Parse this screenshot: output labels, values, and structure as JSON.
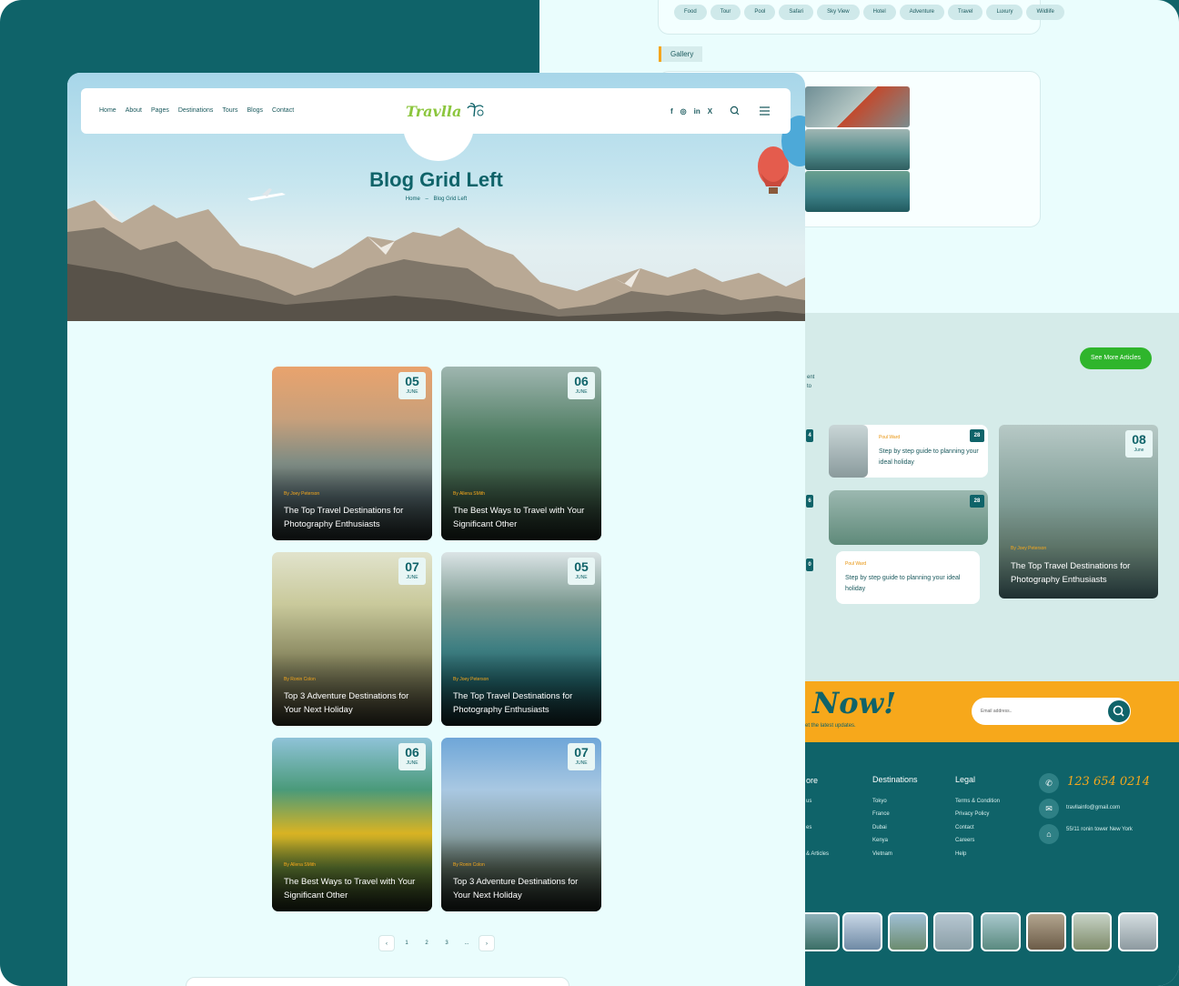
{
  "colors": {
    "teal": "#0f6369",
    "orange": "#f7a81b",
    "green": "#2fb52c",
    "lime": "#8cc63e",
    "mint": "#eafdfd"
  },
  "background_page": {
    "tags": [
      "Food",
      "Tour",
      "Pool",
      "Safari",
      "Sky View",
      "Hotel",
      "Adventure",
      "Travel",
      "Luxury",
      "Wildlife"
    ],
    "gallery_label": "Gallery",
    "see_more": "See More Articles",
    "frag_ent": "ent",
    "frag_to": "to",
    "posts": [
      {
        "author": "Poul Ward",
        "date_day": "28",
        "date_month": "June",
        "title": "Step by step guide to planning your ideal holiday"
      },
      {
        "author": "Poul Ward",
        "date_day": "28",
        "date_month": "June",
        "title": "Step by step guide to planning your ideal holiday"
      }
    ],
    "partial_dates": [
      "4",
      "6",
      "0"
    ],
    "featured": {
      "date_day": "08",
      "date_month": "June",
      "author": "By Joey Peterson",
      "title": "The Top Travel Destinations for Photography Enthusiasts"
    },
    "newsletter": {
      "heading": "Now!",
      "sub": "et the latest updates.",
      "placeholder": "Email address.."
    },
    "footer": {
      "col_more_head": "ore",
      "col_more_links": [
        "us",
        "es",
        "& Articles"
      ],
      "destinations_head": "Destinations",
      "destinations": [
        "Tokyo",
        "France",
        "Dubai",
        "Kenya",
        "Vietnam"
      ],
      "legal_head": "Legal",
      "legal": [
        "Terms & Condition",
        "Privacy Policy",
        "Contact",
        "Careers",
        "Help"
      ],
      "phone": "123 654 0214",
      "email": "travllainfo@gmail.com",
      "address": "55/11 ronin tower New York"
    }
  },
  "nav": {
    "links": [
      "Home",
      "About",
      "Pages",
      "Destinations",
      "Tours",
      "Blogs",
      "Contact"
    ],
    "logo": "Travlla",
    "social": [
      "f",
      "◎",
      "in",
      "X"
    ]
  },
  "hero": {
    "title": "Blog Grid Left",
    "crumb_home": "Home",
    "crumb_sep": "–",
    "crumb_current": "Blog Grid Left"
  },
  "cards": [
    {
      "day": "05",
      "month": "JUNE",
      "author": "By Joey Peterson",
      "title": "The Top Travel Destinations for Photography Enthusiasts"
    },
    {
      "day": "06",
      "month": "JUNE",
      "author": "By Allena SMith",
      "title": "The Best Ways to Travel with Your Significant Other"
    },
    {
      "day": "07",
      "month": "JUNE",
      "author": "By Ronin Colon",
      "title": "Top 3 Adventure Destinations for Your Next Holiday"
    },
    {
      "day": "05",
      "month": "JUNE",
      "author": "By Joey Peterson",
      "title": "The Top Travel Destinations for Photography Enthusiasts"
    },
    {
      "day": "06",
      "month": "JUNE",
      "author": "By Allena SMith",
      "title": "The Best Ways to Travel with Your Significant Other"
    },
    {
      "day": "07",
      "month": "JUNE",
      "author": "By Ronin Colon",
      "title": "Top 3 Adventure Destinations for Your Next Holiday"
    }
  ],
  "pagination": {
    "prev": "‹",
    "pages": [
      "1",
      "2",
      "3",
      "..."
    ],
    "next": "›"
  }
}
